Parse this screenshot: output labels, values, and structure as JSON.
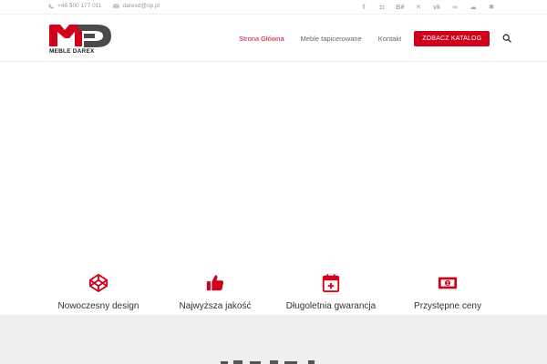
{
  "topbar": {
    "phone": "+48 500 177 011",
    "email": "darexd@op.pl",
    "socials": [
      {
        "icon": "facebook-icon",
        "glyph": "f"
      },
      {
        "icon": "instagram-icon",
        "glyph": "◘"
      },
      {
        "icon": "behance-icon",
        "glyph": "Bē"
      },
      {
        "icon": "xing-icon",
        "glyph": "✕"
      },
      {
        "icon": "vk-icon",
        "glyph": "vk"
      },
      {
        "icon": "tripadvisor-icon",
        "glyph": "∞"
      },
      {
        "icon": "soundcloud-icon",
        "glyph": "☁"
      },
      {
        "icon": "yelp-icon",
        "glyph": "✱"
      }
    ]
  },
  "header": {
    "logo_text": "MEBLE DAREX",
    "nav": [
      {
        "label": "Strona Główna",
        "active": true
      },
      {
        "label": "Meble tapicerowane",
        "active": false
      },
      {
        "label": "Kontakt",
        "active": false
      }
    ],
    "cta_label": "ZOBACZ KATALOG"
  },
  "features": [
    {
      "icon": "codepen-icon",
      "label": "Nowoczesny design"
    },
    {
      "icon": "thumbs-up-icon",
      "label": "Najwyższa jakość"
    },
    {
      "icon": "calendar-plus-icon",
      "label": "Długoletnia gwarancja"
    },
    {
      "icon": "money-bill-icon",
      "label": "Przystępne ceny"
    }
  ],
  "colors": {
    "accent": "#d0021b",
    "active_nav": "#c8102e",
    "muted": "#9a9a9a",
    "band": "#efefef"
  }
}
